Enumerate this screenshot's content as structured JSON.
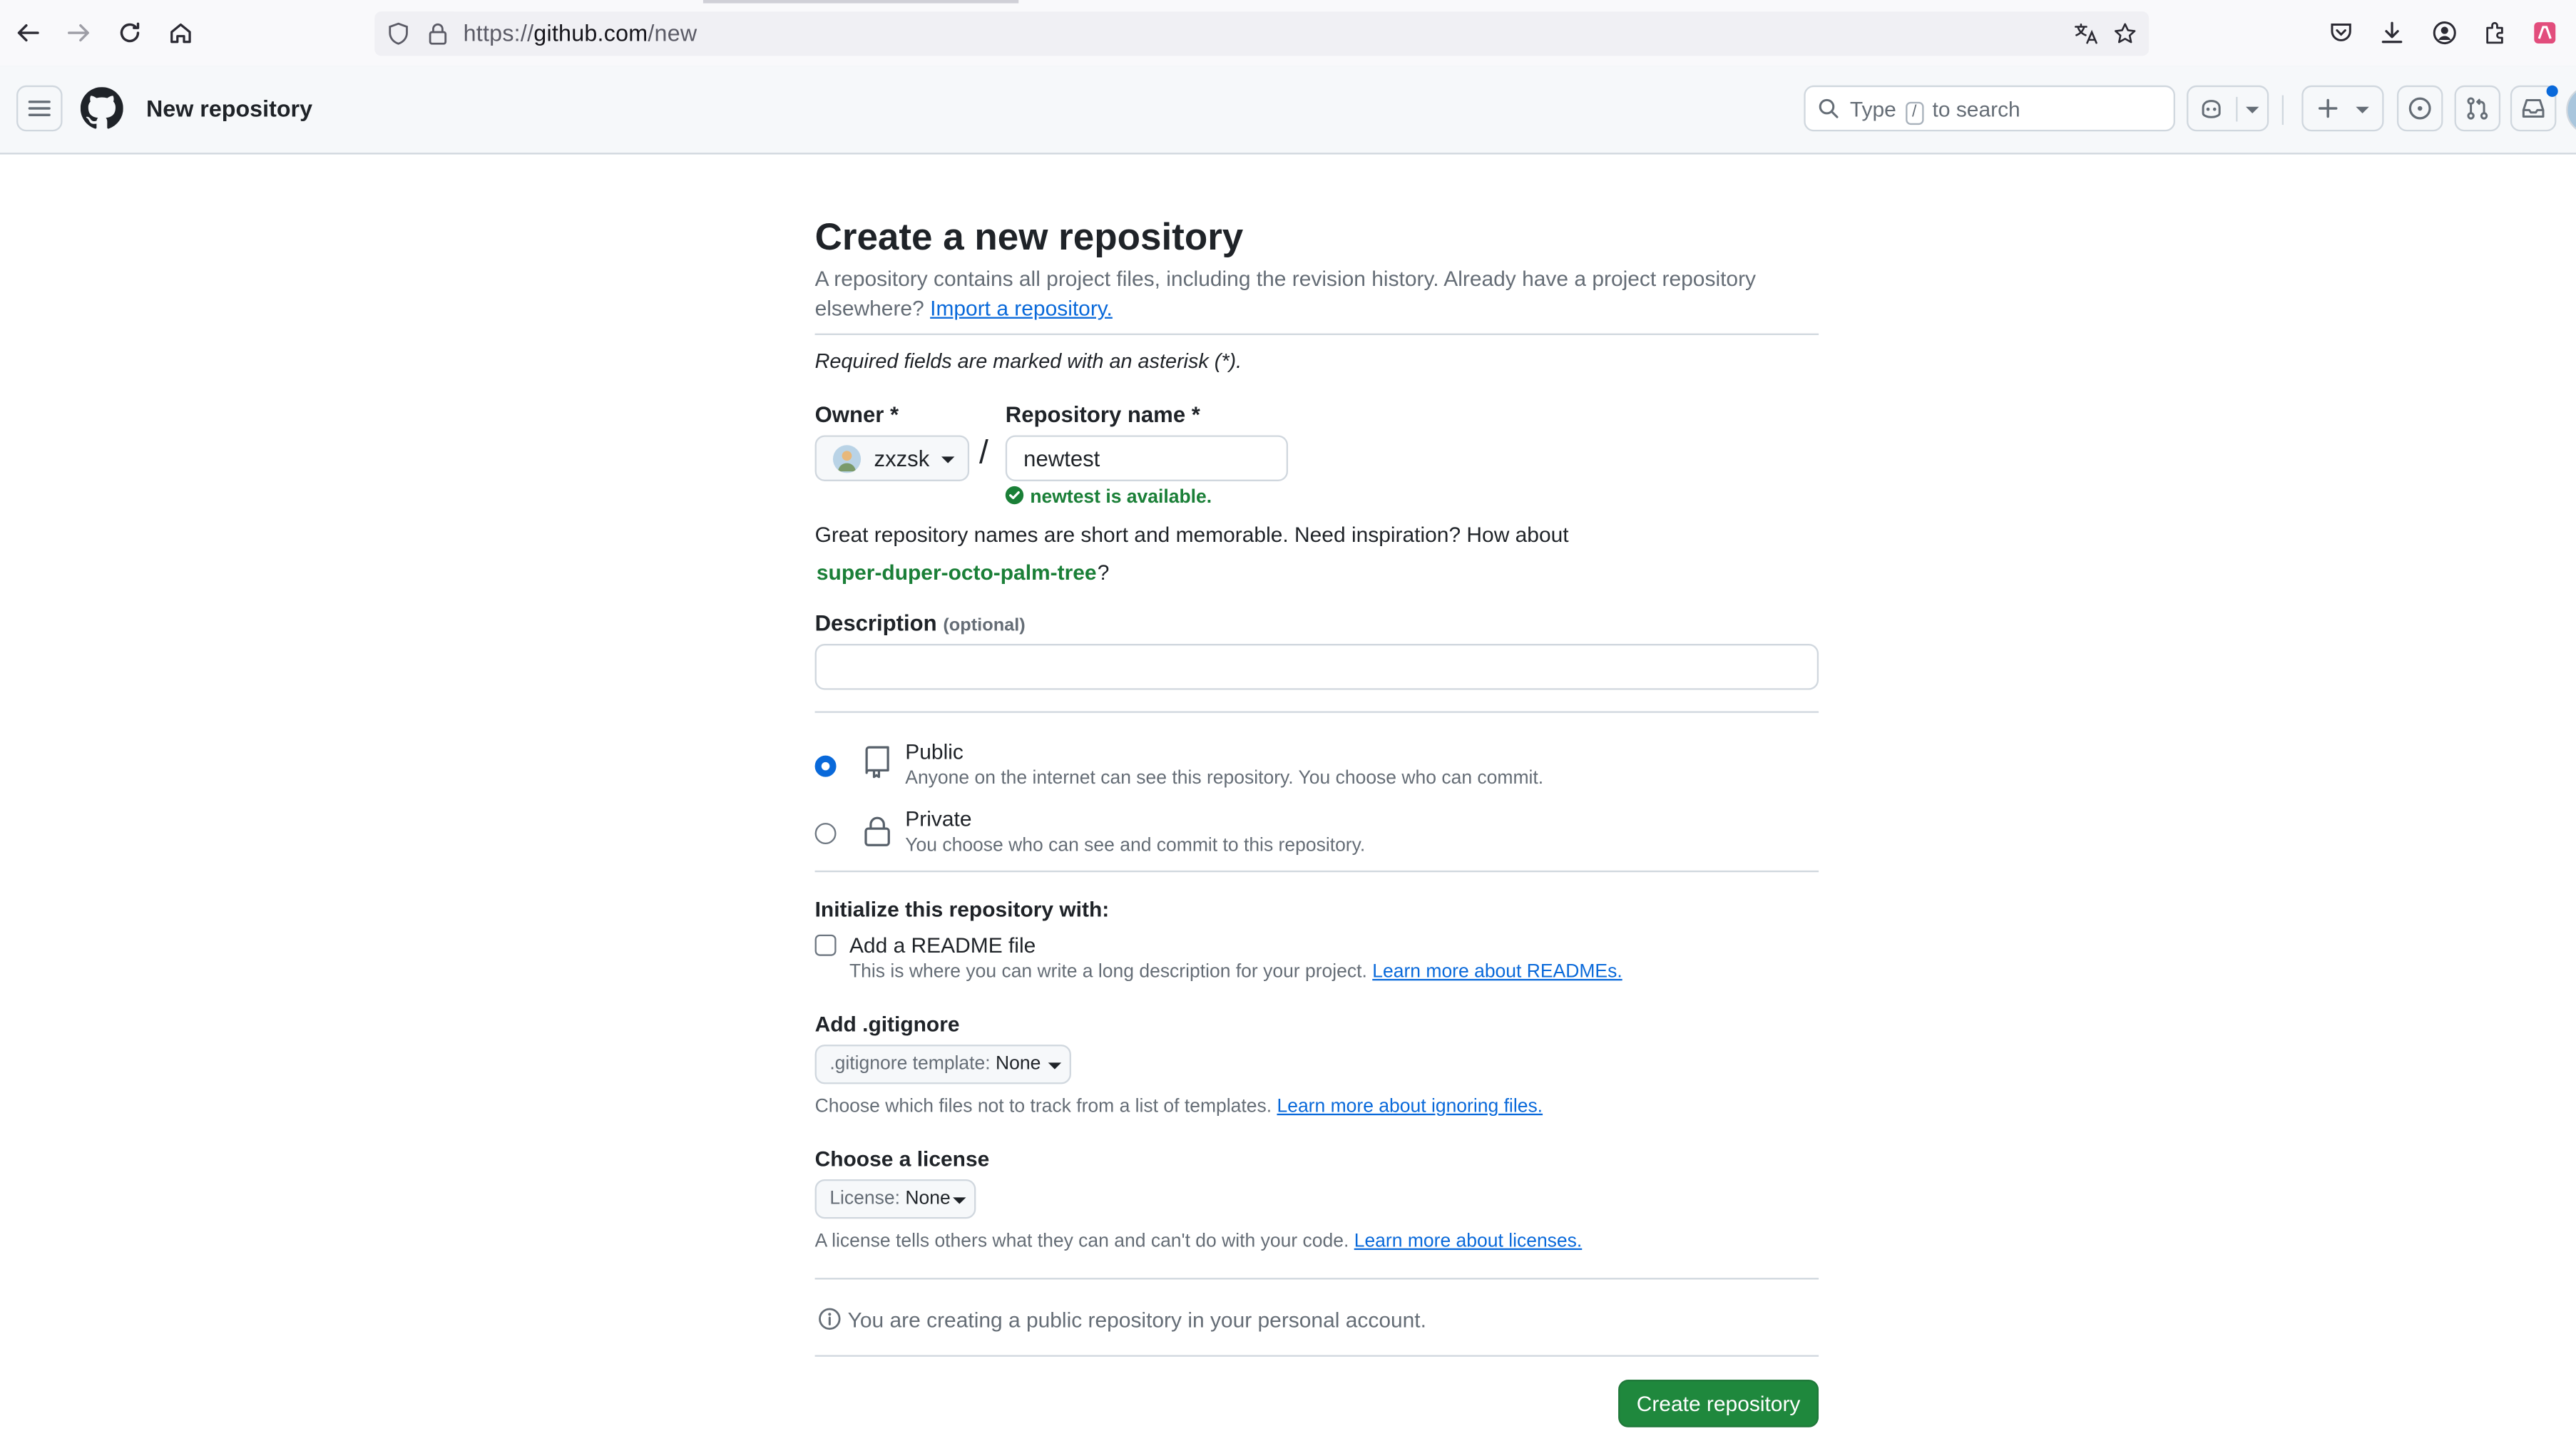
{
  "browser": {
    "url_prefix": "https://",
    "url_host": "github.com",
    "url_path": "/new"
  },
  "header": {
    "context_title": "New repository",
    "search_before": "Type",
    "search_key": "/",
    "search_after": "to search"
  },
  "form": {
    "title": "Create a new repository",
    "subtitle": "A repository contains all project files, including the revision history. Already have a project repository elsewhere?",
    "import_link": "Import a repository.",
    "required_note": "Required fields are marked with an asterisk (*).",
    "owner_label": "Owner *",
    "owner_value": "zxzsk",
    "separator": "/",
    "repo_name_label": "Repository name *",
    "repo_name_value": "newtest",
    "availability": "newtest is available.",
    "suggestion_text": "Great repository names are short and memorable. Need inspiration? How about",
    "suggestion_name": "super-duper-octo-palm-tree",
    "suggestion_end": "?",
    "description_label": "Description",
    "description_optional": "(optional)",
    "description_value": "",
    "visibility": {
      "public_label": "Public",
      "public_desc": "Anyone on the internet can see this repository. You choose who can commit.",
      "private_label": "Private",
      "private_desc": "You choose who can see and commit to this repository.",
      "selected": "Public"
    },
    "init_label": "Initialize this repository with:",
    "readme_label": "Add a README file",
    "readme_checked": false,
    "readme_desc": "This is where you can write a long description for your project.",
    "readme_link": "Learn more about READMEs.",
    "gitignore_label": "Add .gitignore",
    "gitignore_prefix": ".gitignore template:",
    "gitignore_value": "None",
    "gitignore_desc": "Choose which files not to track from a list of templates.",
    "gitignore_link": "Learn more about ignoring files.",
    "license_label": "Choose a license",
    "license_prefix": "License:",
    "license_value": "None",
    "license_desc": "A license tells others what they can and can't do with your code.",
    "license_link": "Learn more about licenses.",
    "info": "You are creating a public repository in your personal account.",
    "submit_label": "Create repository"
  },
  "colors": {
    "accent": "#0969da",
    "success": "#1a7f37",
    "primary_button": "#1f883d"
  }
}
